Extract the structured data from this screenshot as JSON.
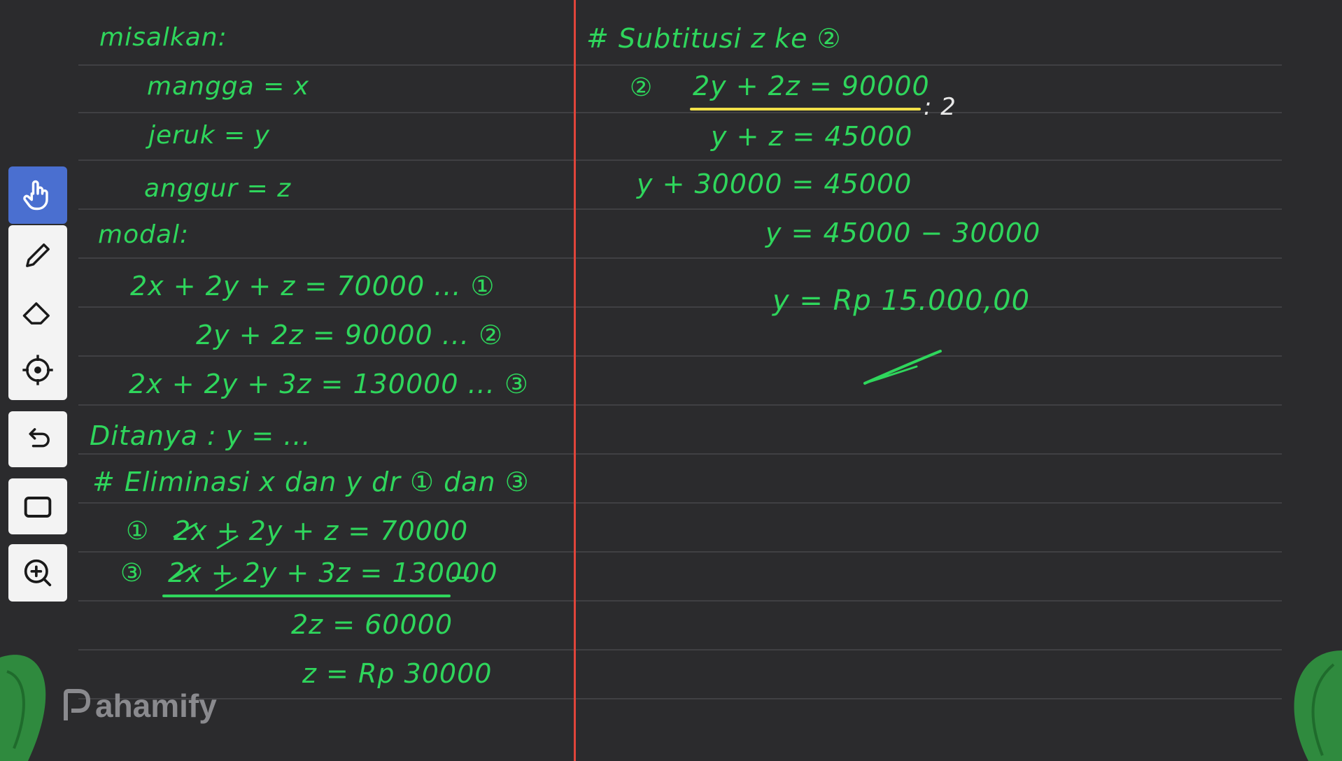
{
  "toolbar": {
    "tools": [
      {
        "icon": "hand-icon",
        "active": true
      },
      {
        "icon": "pen-icon"
      },
      {
        "icon": "eraser-icon"
      },
      {
        "icon": "laser-pointer-icon"
      },
      {
        "icon": "undo-icon"
      },
      {
        "icon": "rectangle-icon"
      },
      {
        "icon": "zoom-in-icon"
      }
    ]
  },
  "left": {
    "misalkan": "misalkan:",
    "mangga": "mangga = x",
    "jeruk": "jeruk = y",
    "anggur": "anggur = z",
    "modal": "modal:",
    "eq1": "2x + 2y + z = 70000 ... ①",
    "eq2": "2y + 2z = 90000 ... ②",
    "eq3": "2x + 2y + 3z = 130000 ... ③",
    "ditanya": "Ditanya : y = ...",
    "elim": "# Eliminasi x dan y dr ① dan ③",
    "elim1_num": "①",
    "elim1": "2x + 2y + z = 70000",
    "elim3_num": "③",
    "elim3": "2x + 2y + 3z = 130000",
    "minus": "−",
    "res1": "2z = 60000",
    "res2": "z = Rp 30000"
  },
  "right": {
    "subst": "# Subtitusi z ke ②",
    "r1_num": "②",
    "r1": "2y + 2z = 90000",
    "div": ": 2",
    "r2": "y + z = 45000",
    "r3": "y + 30000 = 45000",
    "r4": "y = 45000 − 30000",
    "r5": "y = Rp 15.000,00"
  },
  "brand": {
    "logo_text": "ahamify",
    "colors": {
      "background": "#2b2b2d",
      "ink": "#2fd65c",
      "highlight": "#f2e14a",
      "divider": "#e0443a",
      "accent": "#4a6fd0"
    }
  }
}
